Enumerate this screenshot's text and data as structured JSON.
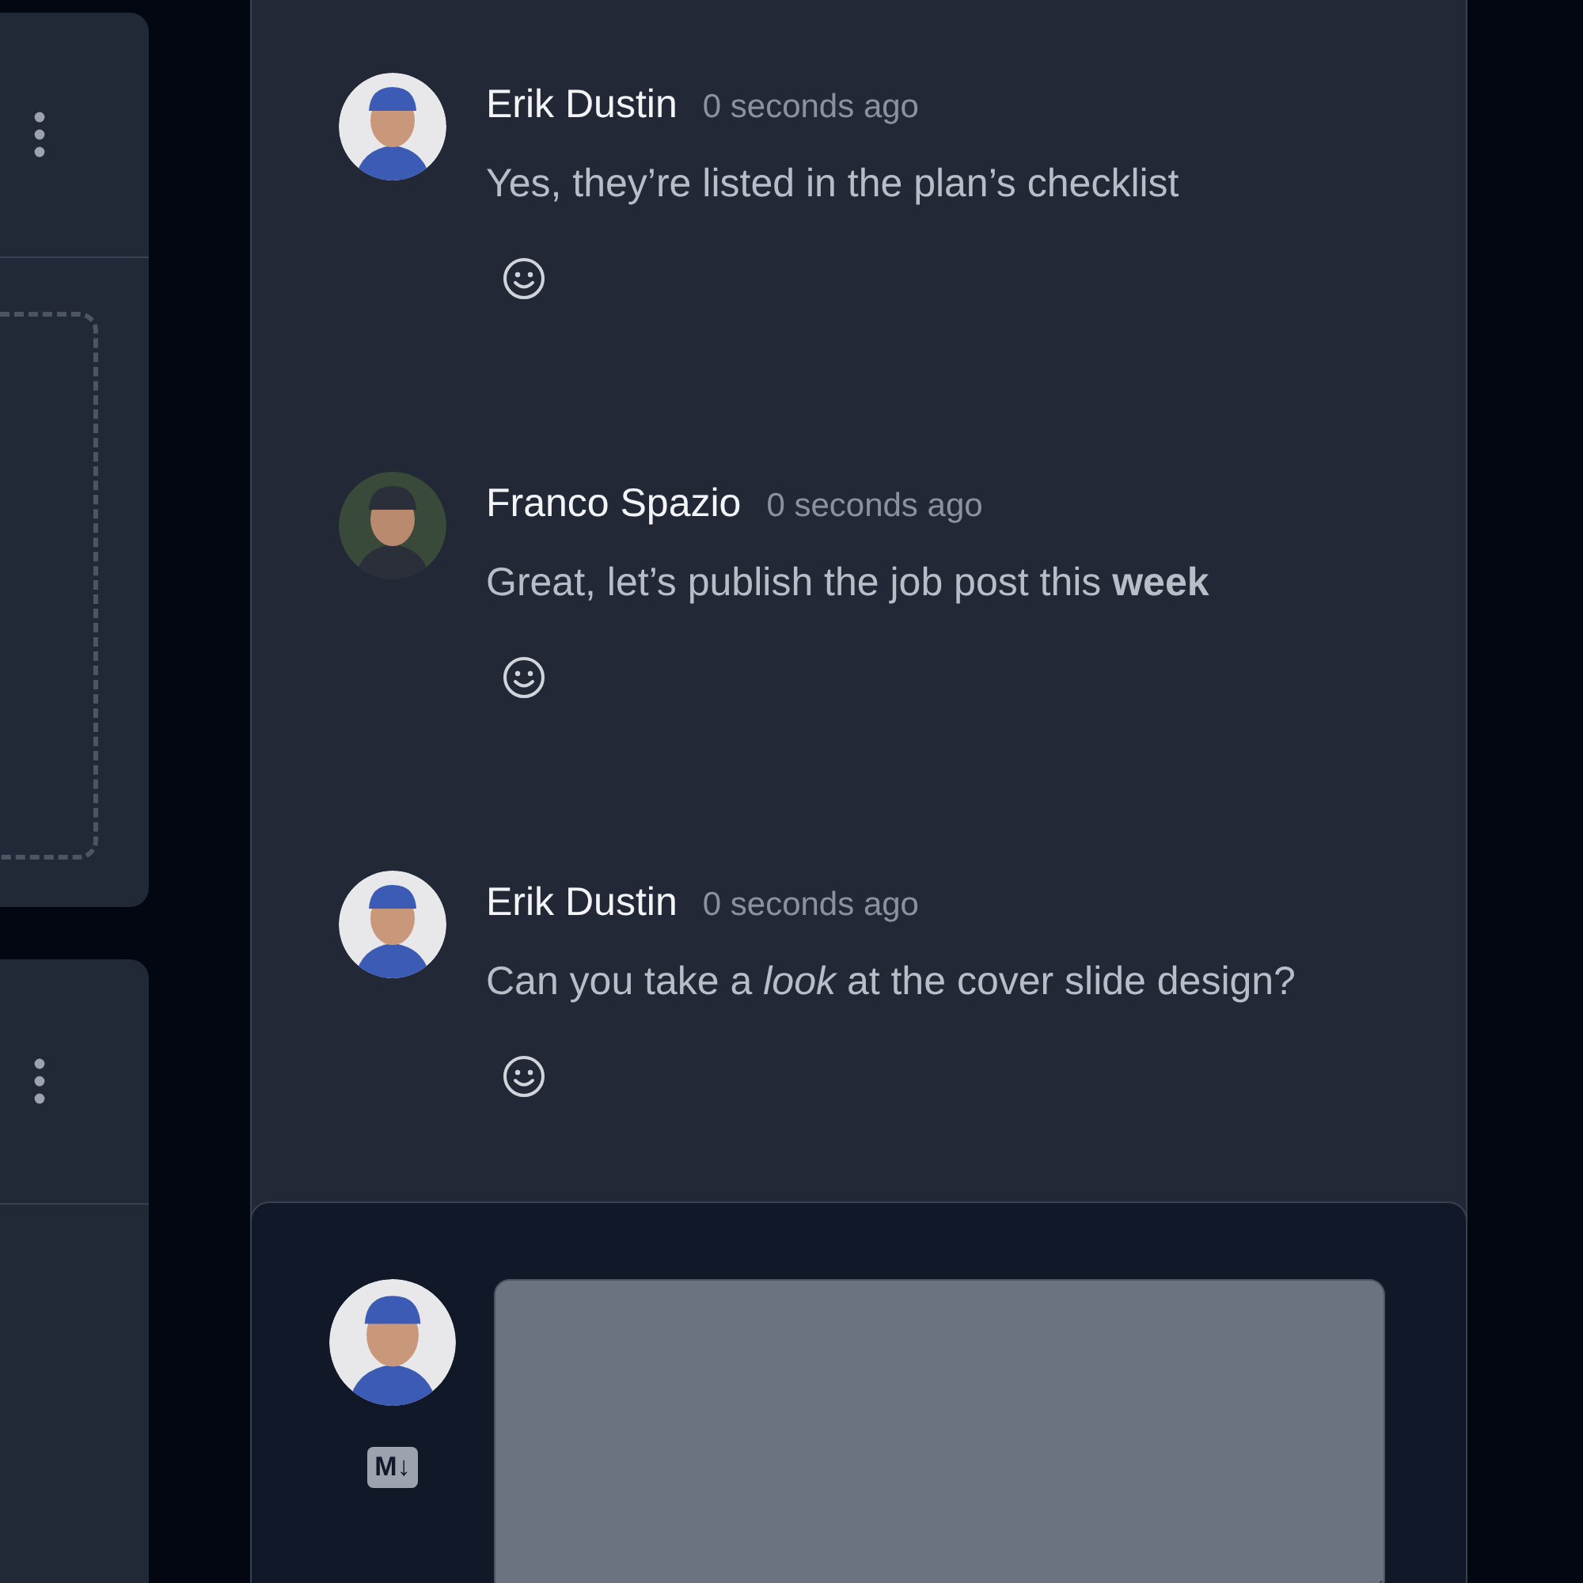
{
  "comments": [
    {
      "author": "Erik Dustin",
      "time": "0 seconds ago",
      "text": "Yes, they’re listed in the plan’s checklist"
    },
    {
      "author": "Franco Spazio",
      "time": "0 seconds ago",
      "text": "Great, let’s publish the job post this **week**"
    },
    {
      "author": "Erik Dustin",
      "time": "0 seconds ago",
      "text": "Can you take a *look* at the cover slide design?"
    }
  ],
  "composer": {
    "markdown_badge": "M↓"
  }
}
